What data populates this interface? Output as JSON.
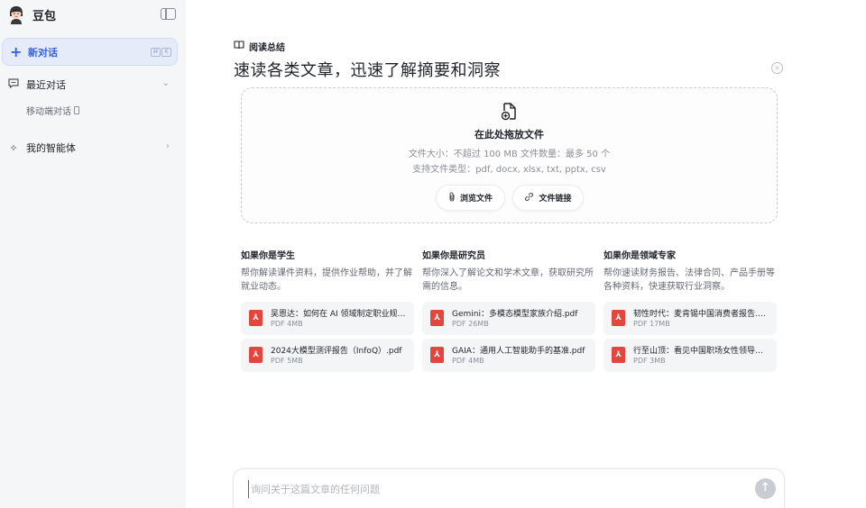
{
  "app": {
    "name": "豆包"
  },
  "sidebar": {
    "new_chat_label": "新对话",
    "recent_label": "最近对话",
    "recent_items": [
      {
        "label": "移动端对话"
      }
    ],
    "agents_label": "我的智能体"
  },
  "main": {
    "tag_label": "阅读总结",
    "headline": "速读各类文章，迅速了解摘要和洞察",
    "dropzone": {
      "title": "在此处拖放文件",
      "limits": "文件大小：不超过 100 MB   文件数量：最多 50 个",
      "types": "支持文件类型：pdf, docx, xlsx, txt, pptx, csv",
      "browse_label": "浏览文件",
      "link_label": "文件链接"
    },
    "personas": [
      {
        "title": "如果你是学生",
        "desc": "帮你解读课件资料，提供作业帮助，并了解就业动态。",
        "files": [
          {
            "name": "吴恩达：如何在 AI 领域制定职业规划.pdf",
            "size": "PDF 4MB"
          },
          {
            "name": "2024大模型测评报告（InfoQ）.pdf",
            "size": "PDF 5MB"
          }
        ]
      },
      {
        "title": "如果你是研究员",
        "desc": "帮你深入了解论文和学术文章，获取研究所需的信息。",
        "files": [
          {
            "name": "Gemini：多模态模型家族介绍.pdf",
            "size": "PDF 26MB"
          },
          {
            "name": "GAIA：通用人工智能助手的基准.pdf",
            "size": "PDF 4MB"
          }
        ]
      },
      {
        "title": "如果你是领域专家",
        "desc": "帮你速读财务报告、法律合同、产品手册等各种资料，快速获取行业洞察。",
        "files": [
          {
            "name": "韧性时代：麦肯锡中国消费者报告.pdf",
            "size": "PDF 17MB"
          },
          {
            "name": "行至山顶：看见中国职场女性领导力.pdf",
            "size": "PDF 3MB"
          }
        ]
      }
    ],
    "input": {
      "placeholder": "询问关于这篇文章的任何问题",
      "value": ""
    }
  },
  "colors": {
    "accent": "#3662e3",
    "pdf": "#e2463e",
    "sidebar_bg": "#f5f6f8"
  },
  "icons": {
    "collapse": "sidebar-toggle-icon",
    "plus": "plus-icon",
    "chat": "chat-bubble-icon",
    "agents": "sparkle-icon",
    "book": "book-icon",
    "upload": "file-upload-icon",
    "paperclip": "paperclip-icon",
    "link": "link-icon",
    "pdf": "pdf-file-icon",
    "send": "arrow-up-icon"
  }
}
